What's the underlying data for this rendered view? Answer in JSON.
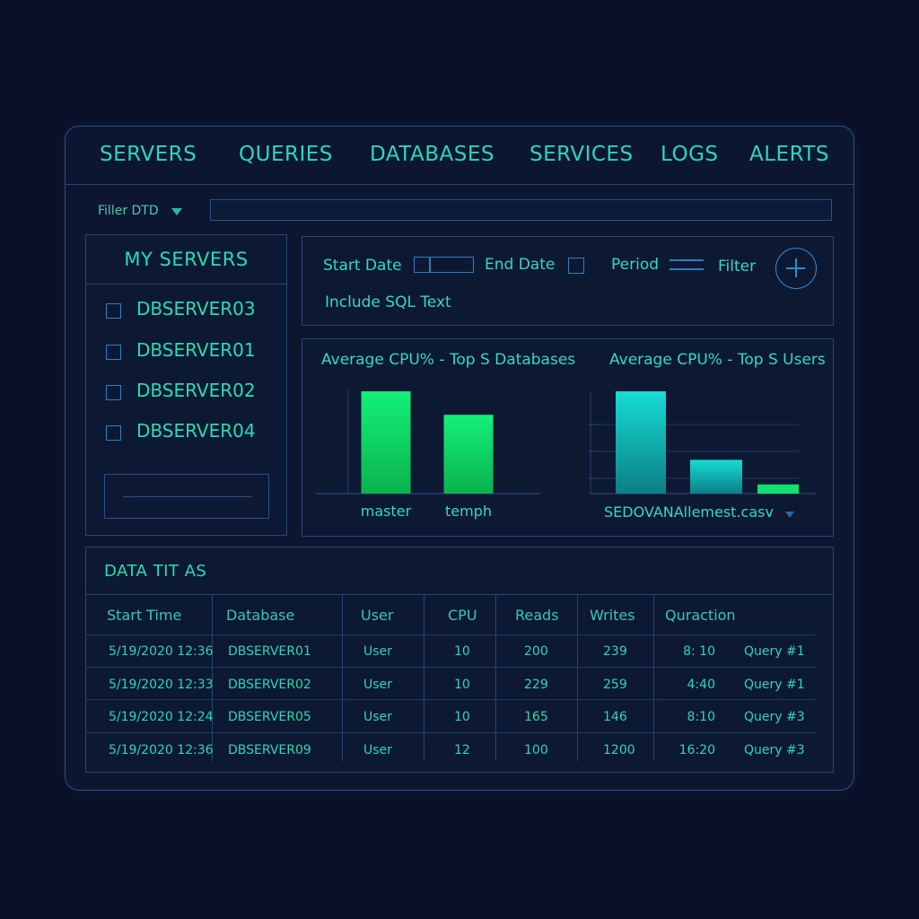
{
  "nav": {
    "items": [
      {
        "label": "SERVERS"
      },
      {
        "label": "QUERIES"
      },
      {
        "label": "DATABASES"
      },
      {
        "label": "SERVICES"
      },
      {
        "label": "LOGS"
      },
      {
        "label": "ALERTS"
      }
    ]
  },
  "filter": {
    "label": "Filler DTD",
    "value": ""
  },
  "servers": {
    "title": "MY SERVERS",
    "items": [
      {
        "name": "DBSERVER03",
        "checked": false
      },
      {
        "name": "DBSERVER01",
        "checked": false
      },
      {
        "name": "DBSERVER02",
        "checked": false
      },
      {
        "name": "DBSERVER04",
        "checked": false
      }
    ]
  },
  "controls": {
    "start_date_label": "Start Date",
    "end_date_label": "End Date",
    "period_label": "Period",
    "filter_label": "Filter",
    "include_sql_label": "Include SQL Text"
  },
  "colors": {
    "accent": "#29dcb4",
    "green_bar": "#11e06a",
    "cyan_bar": "#14d4cc",
    "border": "#244678"
  },
  "chart_data": [
    {
      "type": "bar",
      "title": "Average CPU% - Top S Databases",
      "categories": [
        "master",
        "temph"
      ],
      "values": [
        100,
        77
      ],
      "ylim": [
        0,
        100
      ]
    },
    {
      "type": "bar",
      "title": "Average CPU% - Top S Users",
      "categories": [
        "",
        "",
        ""
      ],
      "values": [
        100,
        33,
        9
      ],
      "ylim": [
        0,
        100
      ],
      "xlabel": "SEDOVANAllemest.casv",
      "grid": true
    }
  ],
  "table": {
    "title": "DATA TIT AS",
    "columns": [
      "Start Time",
      "Database",
      "User",
      "CPU",
      "Reads",
      "Writes",
      "Quraction"
    ],
    "rows": [
      [
        "5/19/2020 12:36",
        "DBSERVER01",
        "User",
        "10",
        "200",
        "239",
        "8: 10",
        "Query #1"
      ],
      [
        "5/19/2020 12:33",
        "DBSERVER02",
        "User",
        "10",
        "229",
        "259",
        "4:40",
        "Query #1"
      ],
      [
        "5/19/2020 12:24",
        "DBSERVER05",
        "User",
        "10",
        "165",
        "146",
        "8:10",
        "Query #3"
      ],
      [
        "5/19/2020 12:36",
        "DBSERVER09",
        "User",
        "12",
        "100",
        "1200",
        "16:20",
        "Query #3"
      ]
    ]
  }
}
